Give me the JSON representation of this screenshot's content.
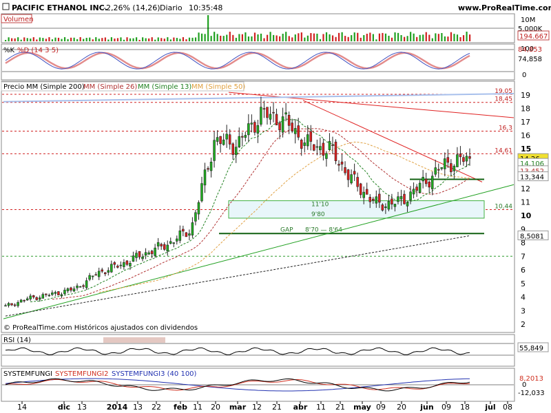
{
  "header": {
    "instrument": "PACIFIC ETHANOL INC.",
    "change": "-2,26% (14,26)",
    "period": "Diario",
    "time": "10:35:48",
    "site": "www.ProRealTime.com"
  },
  "panels": {
    "volume": {
      "label": "Volumen",
      "axis_labels": [
        "10M",
        "5.000K"
      ],
      "last_value": "194.667"
    },
    "stochastic": {
      "legend": [
        "%K",
        "%D (14 3 5)"
      ],
      "axis_labels": [
        "100",
        "0"
      ],
      "value_labels": [
        "84,853",
        "74,858"
      ]
    },
    "price": {
      "legend": [
        "Precio",
        "MM (Simple 200)",
        "MM (Simple 26)",
        "MM (Simple 13)",
        "MM (Simple 50)"
      ],
      "legend_colors": [
        "#000000",
        "#000000",
        "#b03030",
        "#208020",
        "#e0a040"
      ],
      "axis_labels": [
        "19",
        "18",
        "17",
        "16",
        "15",
        "14",
        "13",
        "12",
        "11",
        "10",
        "9",
        "8",
        "7",
        "6",
        "5",
        "4",
        "3",
        "2"
      ],
      "price_levels": [
        "19,05",
        "18,45",
        "16,3",
        "14,61",
        "10,44"
      ],
      "value_labels": [
        "14,26",
        "14,106",
        "13,452",
        "13,344",
        "8,5081"
      ],
      "annotations": [
        "11'10",
        "9'80",
        "GAP",
        "8'70 — 8'64"
      ],
      "footer": "© ProRealTime.com Históricos ajustados con dividendos"
    },
    "rsi": {
      "label": "RSI (14)",
      "last_value": "55,849"
    },
    "systemfungi": {
      "legend": [
        "SYSTEMFUNGI",
        "SYSTEMFUNGI2",
        "SYSTEMFUNGI3 (40 100)"
      ],
      "legend_colors": [
        "#000000",
        "#d03020",
        "#2030b0"
      ],
      "value_labels": [
        "8,2013",
        "0",
        "-12,033"
      ]
    }
  },
  "xaxis": {
    "labels": [
      "14",
      "dic",
      "13",
      "2014",
      "13",
      "22",
      "feb",
      "11",
      "20",
      "mar",
      "12",
      "21",
      "abr",
      "11",
      "21",
      "may",
      "09",
      "20",
      "jun",
      "09",
      "18",
      "jul",
      "08"
    ]
  },
  "chart_data": {
    "type": "candlestick",
    "title": "PACIFIC ETHANOL INC.",
    "period": "Diario",
    "x": [
      "2013-11-14",
      "2013-12",
      "2013-12-13",
      "2014-01",
      "2014-01-13",
      "2014-01-22",
      "2014-02",
      "2014-02-11",
      "2014-02-20",
      "2014-03",
      "2014-03-12",
      "2014-03-21",
      "2014-04",
      "2014-04-11",
      "2014-04-21",
      "2014-05",
      "2014-05-09",
      "2014-05-20",
      "2014-06",
      "2014-06-09",
      "2014-06-18"
    ],
    "close": [
      3.3,
      3.9,
      4.2,
      4.6,
      5.8,
      6.4,
      7.2,
      7.9,
      9.0,
      15.6,
      15.3,
      17.6,
      17.1,
      15.3,
      14.9,
      12.5,
      10.8,
      11.0,
      12.4,
      13.9,
      14.26
    ],
    "ylim": [
      2,
      20
    ],
    "last": 14.26,
    "change_pct": -2.26,
    "moving_averages": [
      {
        "name": "MM (Simple 200)",
        "last": 8.5081
      },
      {
        "name": "MM (Simple 26)",
        "last": 13.452
      },
      {
        "name": "MM (Simple 13)",
        "last": 14.106
      },
      {
        "name": "MM (Simple 50)",
        "last": 13.344
      }
    ],
    "horizontal_levels": [
      19.05,
      18.45,
      16.3,
      14.61,
      10.44,
      7.0
    ],
    "zones": [
      {
        "label": "11'10 / 9'80",
        "from": 9.8,
        "to": 11.1
      },
      {
        "label": "GAP 8'70 — 8'64",
        "from": 8.64,
        "to": 8.7
      }
    ],
    "indicators": {
      "rsi_14": 55.849,
      "stochastic_k": 74.858,
      "stochastic_d": 84.853,
      "volume_last": 194667,
      "systemfungi": [
        8.2013,
        0,
        -12.033
      ]
    }
  }
}
